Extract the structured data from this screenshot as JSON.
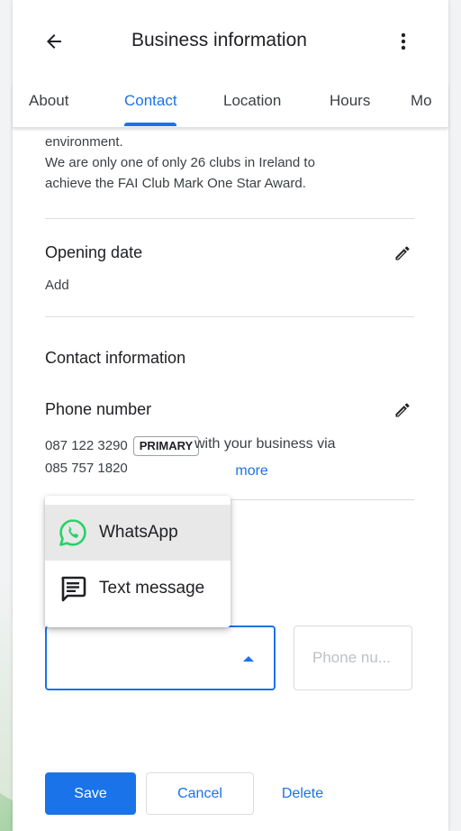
{
  "header": {
    "title": "Business information",
    "back_icon": "arrow-back-icon",
    "more_icon": "more-vert-icon"
  },
  "tabs": [
    {
      "label": "About",
      "active": false
    },
    {
      "label": "Contact",
      "active": true
    },
    {
      "label": "Location",
      "active": false
    },
    {
      "label": "Hours",
      "active": false
    },
    {
      "label": "Mo",
      "active": false
    }
  ],
  "description": {
    "line1": "environment.",
    "line2": "We are only one of only 26 clubs in Ireland to",
    "line3": "achieve the FAI Club Mark One Star Award."
  },
  "opening_date": {
    "label": "Opening date",
    "value": "Add"
  },
  "contact": {
    "heading": "Contact information",
    "phone_label": "Phone number",
    "primary_phone": "087 122 3290",
    "primary_badge": "PRIMARY",
    "secondary_phone": "085 757 1820",
    "helper_text": "with your business via",
    "learn_more": "more"
  },
  "menu": {
    "items": [
      {
        "label": "WhatsApp",
        "icon": "whatsapp-icon",
        "selected": true
      },
      {
        "label": "Text message",
        "icon": "text-message-icon",
        "selected": false
      }
    ]
  },
  "form": {
    "select_value": "",
    "phone_placeholder": "Phone nu..."
  },
  "buttons": {
    "save": "Save",
    "cancel": "Cancel",
    "delete": "Delete"
  },
  "colors": {
    "accent": "#1a73e8",
    "whatsapp": "#25d366"
  }
}
